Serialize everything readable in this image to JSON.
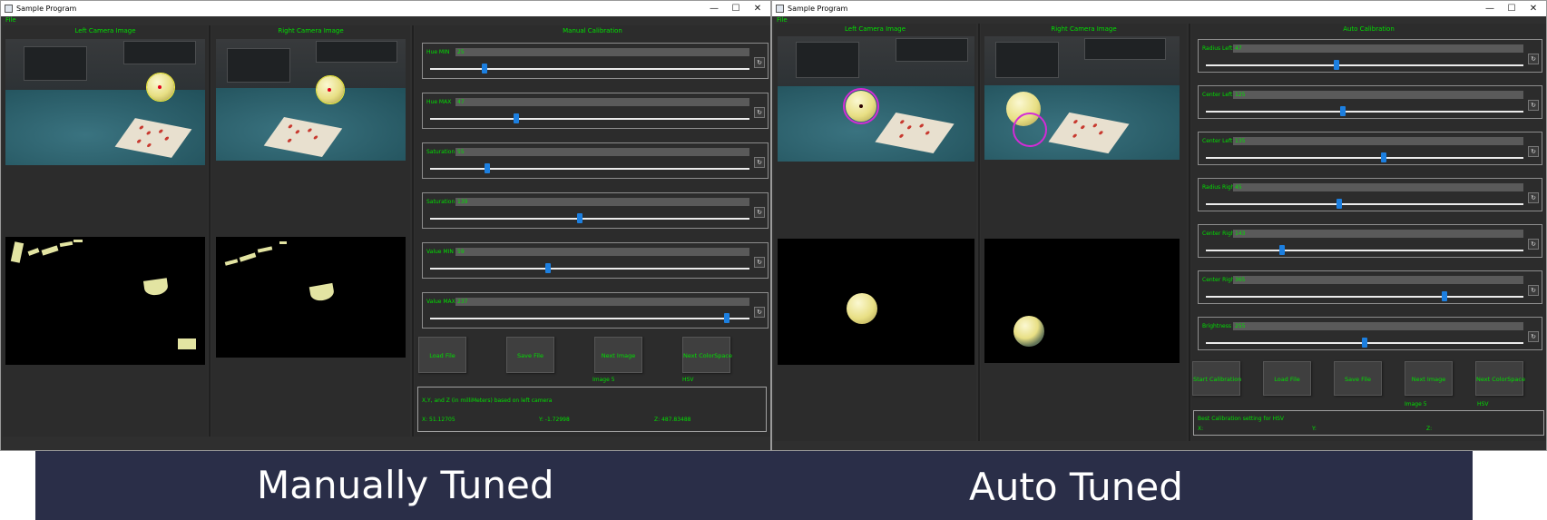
{
  "left_window": {
    "title": "Sample Program",
    "menu": "File",
    "left_camera_header": "Left Camera Image",
    "right_camera_header": "Right Camera Image",
    "panel_header": "Manual Calibration",
    "sliders": [
      {
        "label": "Hue MIN",
        "value": "25",
        "level": 0.17
      },
      {
        "label": "Hue MAX",
        "value": "47",
        "level": 0.27
      },
      {
        "label": "Saturation MIN",
        "value": "55",
        "level": 0.18
      },
      {
        "label": "Saturation MAX",
        "value": "139",
        "level": 0.47
      },
      {
        "label": "Value MIN",
        "value": "59",
        "level": 0.37
      },
      {
        "label": "Value MAX",
        "value": "237",
        "level": 0.93
      }
    ],
    "buttons": [
      "Load File",
      "Save File",
      "Next Image",
      "Next ColorSpace"
    ],
    "image_indicator": "Image 5",
    "colorspace_indicator": "HSV",
    "output_title": "X,Y, and Z (in milliMeters) based on left camera",
    "x_text": "X: 51.12705",
    "y_text": "Y: -1.72998",
    "z_text": "Z: 487.83488"
  },
  "right_window": {
    "title": "Sample Program",
    "menu": "File",
    "left_camera_header": "Left Camera Image",
    "right_camera_header": "Right Camera Image",
    "panel_header": "Auto Calibration",
    "sliders": [
      {
        "label": "Radius Left",
        "value": "47",
        "level": 0.41
      },
      {
        "label": "Center Left X",
        "value": "125",
        "level": 0.43
      },
      {
        "label": "Center Left Y",
        "value": "135",
        "level": 0.56
      },
      {
        "label": "Radius Right",
        "value": "45",
        "level": 0.42
      },
      {
        "label": "Center Right X",
        "value": "143",
        "level": 0.24
      },
      {
        "label": "Center Right Y",
        "value": "365",
        "level": 0.75
      },
      {
        "label": "Brightness",
        "value": "255",
        "level": 0.5
      }
    ],
    "buttons": [
      "Start Calibration",
      "Load File",
      "Save File",
      "Next Image",
      "Next ColorSpace"
    ],
    "image_indicator": "Image 5",
    "colorspace_indicator": "HSV",
    "output_title": "Best Calibration setting for HSV",
    "x_text": "X:",
    "y_text": "Y:",
    "z_text": "Z:"
  },
  "icons": {
    "minimize": "minimize-icon",
    "maximize": "maximize-icon",
    "close": "close-icon",
    "reset": "reset-icon"
  },
  "colors": {
    "accent_text": "#00e000",
    "slider_thumb": "#1c7fe0",
    "banner": "#2a2e48",
    "ring_left": "#f0ed3a",
    "ring_right": "#d42bd6"
  },
  "captions": {
    "left": "Manually Tuned",
    "right": "Auto Tuned"
  }
}
